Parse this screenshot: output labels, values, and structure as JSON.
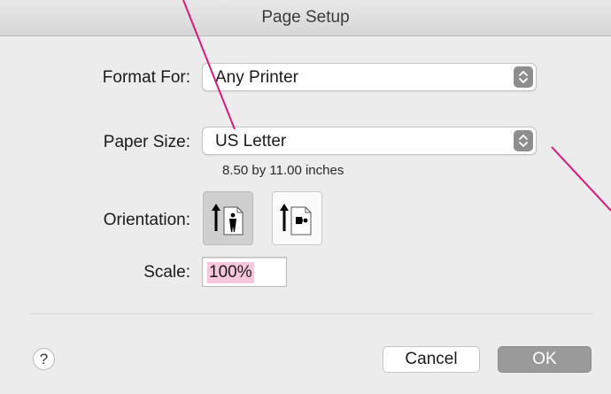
{
  "window": {
    "title": "Page Setup"
  },
  "format_for": {
    "label": "Format For:",
    "value": "Any Printer"
  },
  "paper_size": {
    "label": "Paper Size:",
    "value": "US Letter",
    "hint": "8.50 by 11.00 inches"
  },
  "orientation": {
    "label": "Orientation:",
    "options": [
      "portrait",
      "landscape"
    ],
    "selected": "portrait"
  },
  "scale": {
    "label": "Scale:",
    "value": "100%"
  },
  "buttons": {
    "help": "?",
    "cancel": "Cancel",
    "ok": "OK"
  },
  "colors": {
    "annotation_line": "#d81b7a",
    "text_highlight": "#f7c7de",
    "default_button": "#9a9a9a"
  }
}
